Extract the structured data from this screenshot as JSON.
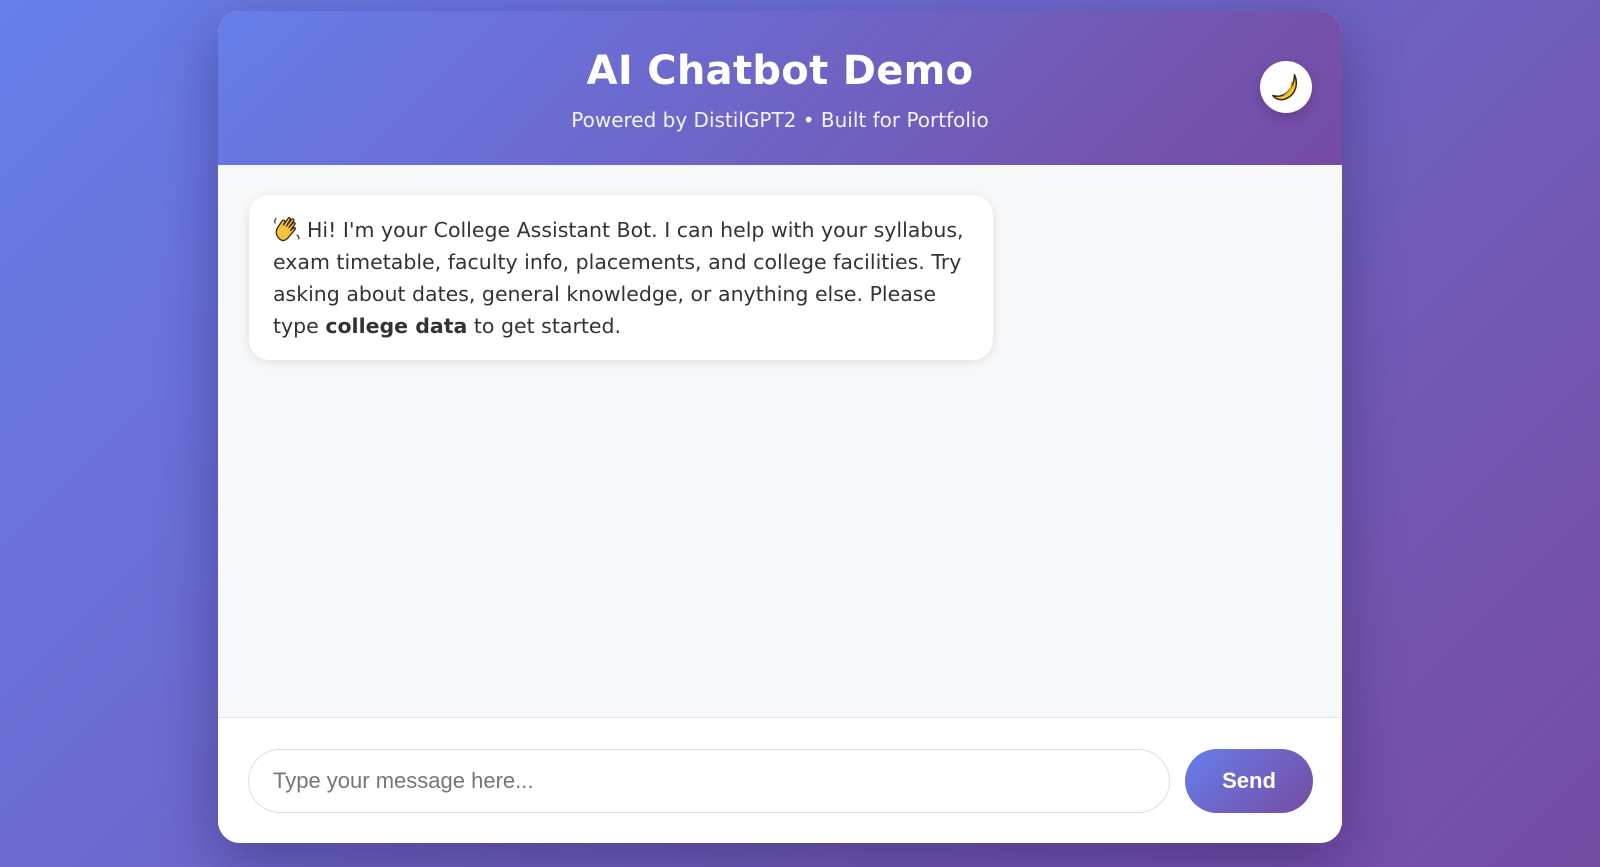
{
  "header": {
    "title": "AI Chatbot Demo",
    "subtitle": "Powered by DistilGPT2 • Built for Portfolio",
    "theme_toggle_icon": "moon-icon"
  },
  "messages": [
    {
      "sender": "bot",
      "icon": "waving-hand-icon",
      "text_before": "Hi! I'm your College Assistant Bot. I can help with your syllabus, exam timetable, faculty info, placements, and college facilities. Try asking about dates, general knowledge, or anything else. Please type ",
      "bold_text": "college data",
      "text_after": " to get started."
    }
  ],
  "input": {
    "placeholder": "Type your message here...",
    "value": "",
    "send_label": "Send"
  },
  "colors": {
    "gradient_start": "#667eea",
    "gradient_end": "#764ba2",
    "chat_background": "#f7f8fa",
    "bubble_background": "#ffffff",
    "text": "#333333"
  }
}
